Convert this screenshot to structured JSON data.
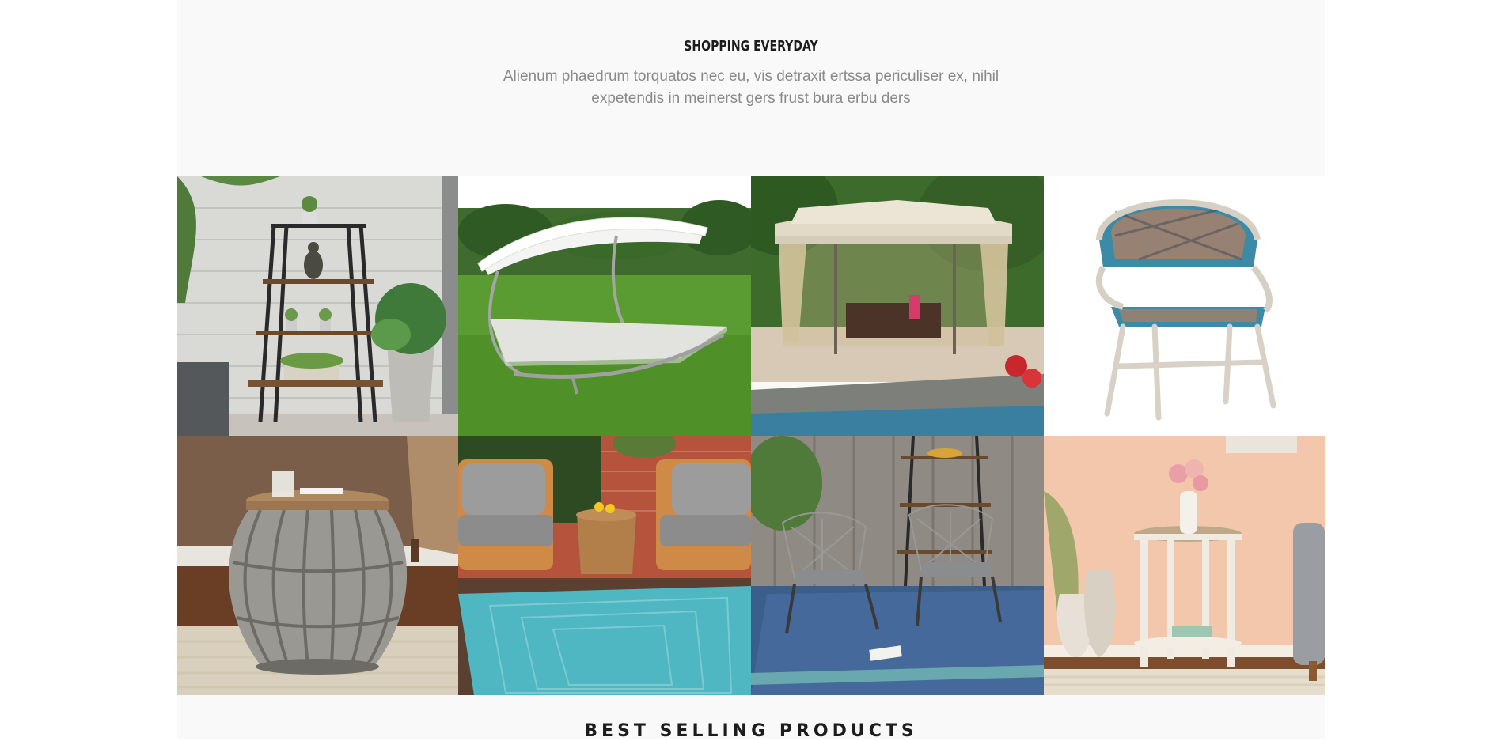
{
  "intro": {
    "title": "SHOPPING EVERYDAY",
    "description": "Alienum phaedrum torquatos nec eu, vis detraxit ertssa periculiser ex, nihil expetendis in meinerst gers frust bura erbu ders"
  },
  "gallery": {
    "items": [
      {
        "subject": "plant-shelf"
      },
      {
        "subject": "canopy-double-lounger"
      },
      {
        "subject": "gazebo-by-pool"
      },
      {
        "subject": "wicker-bistro-chair"
      },
      {
        "subject": "metal-barrel-side-table"
      },
      {
        "subject": "teak-club-chairs-on-rug"
      },
      {
        "subject": "rope-chairs-on-blue-rug"
      },
      {
        "subject": "white-round-end-table"
      }
    ]
  },
  "section": {
    "title": "BEST SELLING PRODUCTS"
  }
}
